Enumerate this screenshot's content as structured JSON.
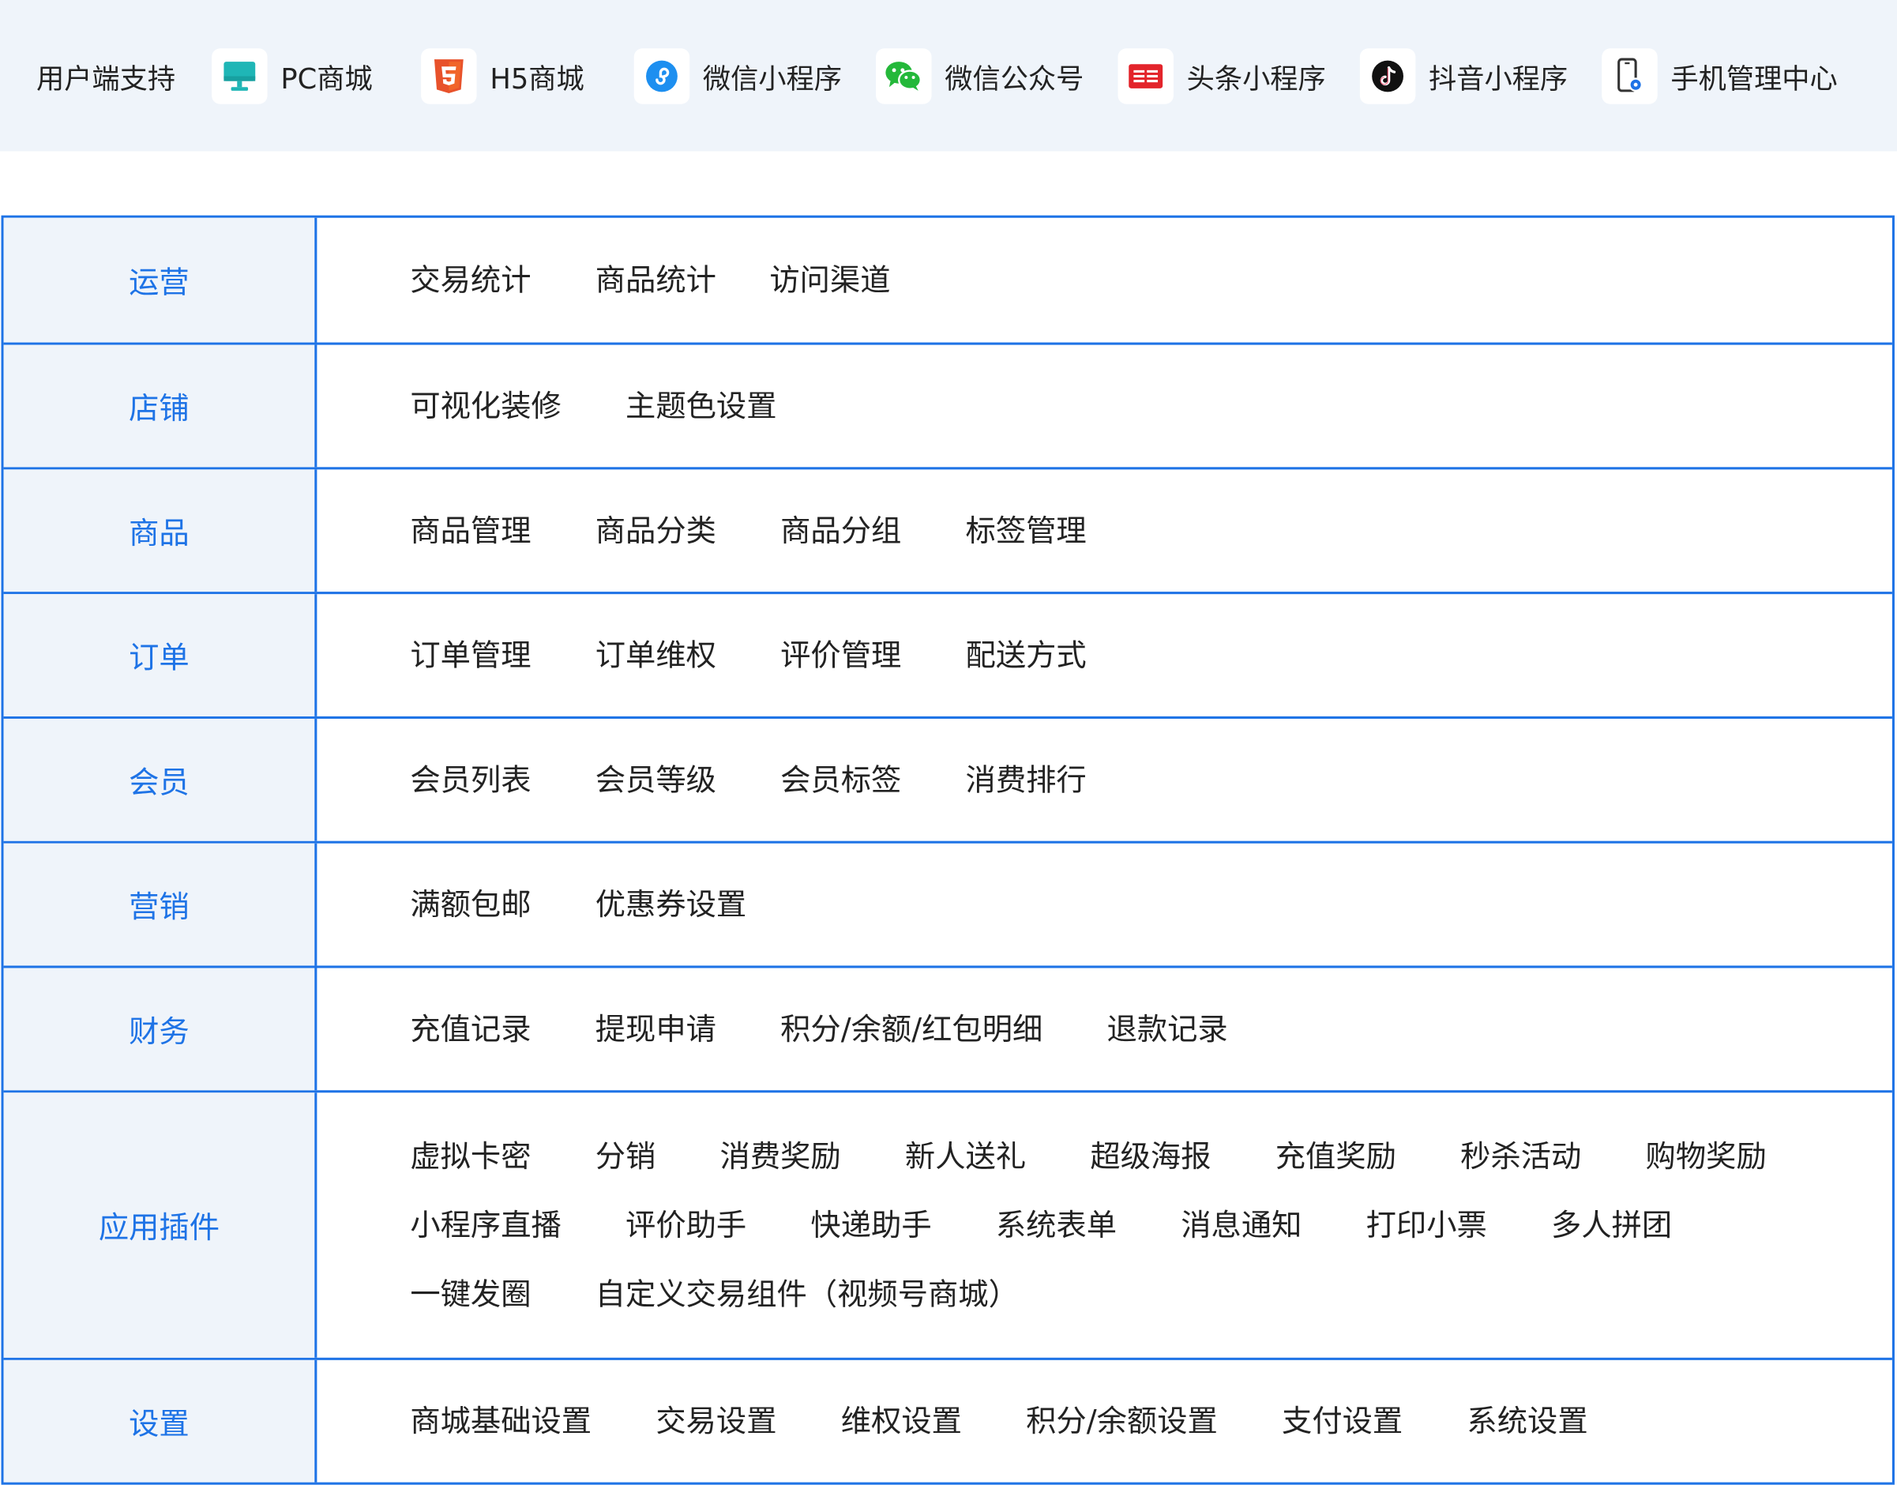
{
  "banner": {
    "title": "用户端支持",
    "clients": [
      {
        "label": "PC商城",
        "icon": "desktop-icon",
        "color": "#1fb6b6"
      },
      {
        "label": "H5商城",
        "icon": "html5-icon",
        "color": "#e8522b"
      },
      {
        "label": "微信小程序",
        "icon": "wechat-miniprogram-icon",
        "color": "#1d8ff0"
      },
      {
        "label": "微信公众号",
        "icon": "wechat-icon",
        "color": "#24b83a"
      },
      {
        "label": "头条小程序",
        "icon": "toutiao-icon",
        "color": "#e3242b"
      },
      {
        "label": "抖音小程序",
        "icon": "douyin-icon",
        "color": "#111111"
      },
      {
        "label": "手机管理中心",
        "icon": "mobile-manage-icon",
        "color": "#1e73e6"
      }
    ]
  },
  "table": {
    "accent": "#1e73e6",
    "rows": [
      {
        "head": "运营",
        "items": [
          "交易统计",
          "商品统计",
          "访问渠道"
        ]
      },
      {
        "head": "店铺",
        "items": [
          "可视化装修",
          "主题色设置"
        ]
      },
      {
        "head": "商品",
        "items": [
          "商品管理",
          "商品分类",
          "商品分组",
          "标签管理"
        ]
      },
      {
        "head": "订单",
        "items": [
          "订单管理",
          "订单维权",
          "评价管理",
          "配送方式"
        ]
      },
      {
        "head": "会员",
        "items": [
          "会员列表",
          "会员等级",
          "会员标签",
          "消费排行"
        ]
      },
      {
        "head": "营销",
        "items": [
          "满额包邮",
          "优惠券设置"
        ]
      },
      {
        "head": "财务",
        "items": [
          "充值记录",
          "提现申请",
          "积分/余额/红包明细",
          "退款记录"
        ]
      },
      {
        "head": "应用插件",
        "items": [
          "虚拟卡密",
          "分销",
          "消费奖励",
          "新人送礼",
          "超级海报",
          "充值奖励",
          "秒杀活动",
          "购物奖励",
          "小程序直播",
          "评价助手",
          "快递助手",
          "系统表单",
          "消息通知",
          "打印小票",
          "多人拼团",
          "一键发圈",
          "自定义交易组件（视频号商城）"
        ]
      },
      {
        "head": "设置",
        "items": [
          "商城基础设置",
          "交易设置",
          "维权设置",
          "积分/余额设置",
          "支付设置",
          "系统设置"
        ]
      }
    ]
  }
}
